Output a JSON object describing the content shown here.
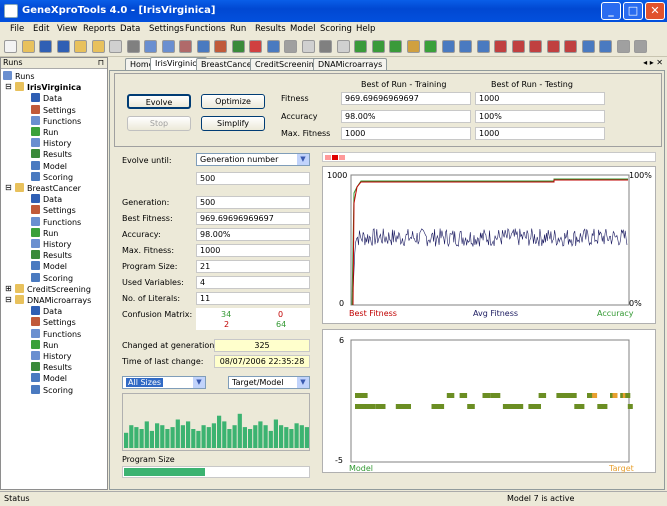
{
  "window": {
    "title": "GeneXproTools 4.0 - [IrisVirginica]"
  },
  "menu": [
    "File",
    "Edit",
    "View",
    "Reports",
    "Data",
    "Settings",
    "Functions",
    "Run",
    "Results",
    "Model",
    "Scoring",
    "Help"
  ],
  "runs_pane": {
    "title": "Runs",
    "root": "Runs",
    "projects": [
      {
        "name": "IrisVirginica",
        "bold": true,
        "expanded": true,
        "items": [
          "Data",
          "Settings",
          "Functions",
          "Run",
          "History",
          "Results",
          "Model",
          "Scoring"
        ]
      },
      {
        "name": "BreastCancer",
        "expanded": true,
        "items": [
          "Data",
          "Settings",
          "Functions",
          "Run",
          "History",
          "Results",
          "Model",
          "Scoring"
        ]
      },
      {
        "name": "CreditScreening",
        "expanded": false,
        "items": []
      },
      {
        "name": "DNAMicroarrays",
        "expanded": true,
        "items": [
          "Data",
          "Settings",
          "Functions",
          "Run",
          "History",
          "Results",
          "Model",
          "Scoring"
        ]
      }
    ]
  },
  "tabs": [
    "Home",
    "IrisVirginica",
    "BreastCancer",
    "CreditScreening",
    "DNAMicroarrays"
  ],
  "active_tab": "IrisVirginica",
  "controls": {
    "evolve": "Evolve",
    "optimize": "Optimize",
    "stop": "Stop",
    "simplify": "Simplify"
  },
  "best": {
    "training_header": "Best of Run - Training",
    "testing_header": "Best of Run - Testing",
    "rows": [
      {
        "label": "Fitness",
        "training": "969.69696969697",
        "testing": "1000"
      },
      {
        "label": "Accuracy",
        "training": "98.00%",
        "testing": "100%"
      },
      {
        "label": "Max. Fitness",
        "training": "1000",
        "testing": "1000"
      }
    ]
  },
  "stats": {
    "evolve_until_label": "Evolve until:",
    "evolve_until_value": "Generation number",
    "evolve_until_target": "500",
    "rows": [
      {
        "label": "Generation:",
        "value": "500"
      },
      {
        "label": "Best Fitness:",
        "value": "969.69696969697"
      },
      {
        "label": "Accuracy:",
        "value": "98.00%"
      },
      {
        "label": "Max. Fitness:",
        "value": "1000"
      },
      {
        "label": "Program Size:",
        "value": "21"
      },
      {
        "label": "Used Variables:",
        "value": "4"
      },
      {
        "label": "No. of Literals:",
        "value": "11"
      }
    ],
    "confusion_label": "Confusion Matrix:",
    "confusion": [
      "34",
      "0",
      "2",
      "64"
    ],
    "changed_label": "Changed at generation:",
    "changed_value": "325",
    "time_label": "Time of last change:",
    "time_value": "08/07/2006 22:35:28"
  },
  "size_select": "All Sizes",
  "target_select": "Target/Model",
  "program_size_label": "Program Size",
  "program_size_bars": [
    0.4,
    0.6,
    0.55,
    0.5,
    0.7,
    0.45,
    0.65,
    0.6,
    0.5,
    0.55,
    0.75,
    0.6,
    0.7,
    0.5,
    0.45,
    0.6,
    0.55,
    0.65,
    0.85,
    0.7,
    0.5,
    0.6,
    0.9,
    0.55,
    0.5,
    0.6,
    0.7,
    0.6,
    0.45,
    0.75,
    0.6,
    0.55,
    0.5,
    0.65,
    0.6,
    0.55
  ],
  "fitness_chart": {
    "ymax_left": "1000",
    "ymax_right": "100%",
    "ymin_left": "0",
    "ymin_right": "0%",
    "legend": [
      "Best Fitness",
      "Avg Fitness",
      "Accuracy"
    ],
    "colors": {
      "best": "#c00000",
      "avg": "#1a1a60",
      "acc": "#339933"
    }
  },
  "model_chart": {
    "ymax": "6",
    "ymin": "-5",
    "xlabel_left": "Model",
    "xlabel_right": "Target"
  },
  "status": {
    "left": "Status",
    "right": "Model 7 is active"
  }
}
